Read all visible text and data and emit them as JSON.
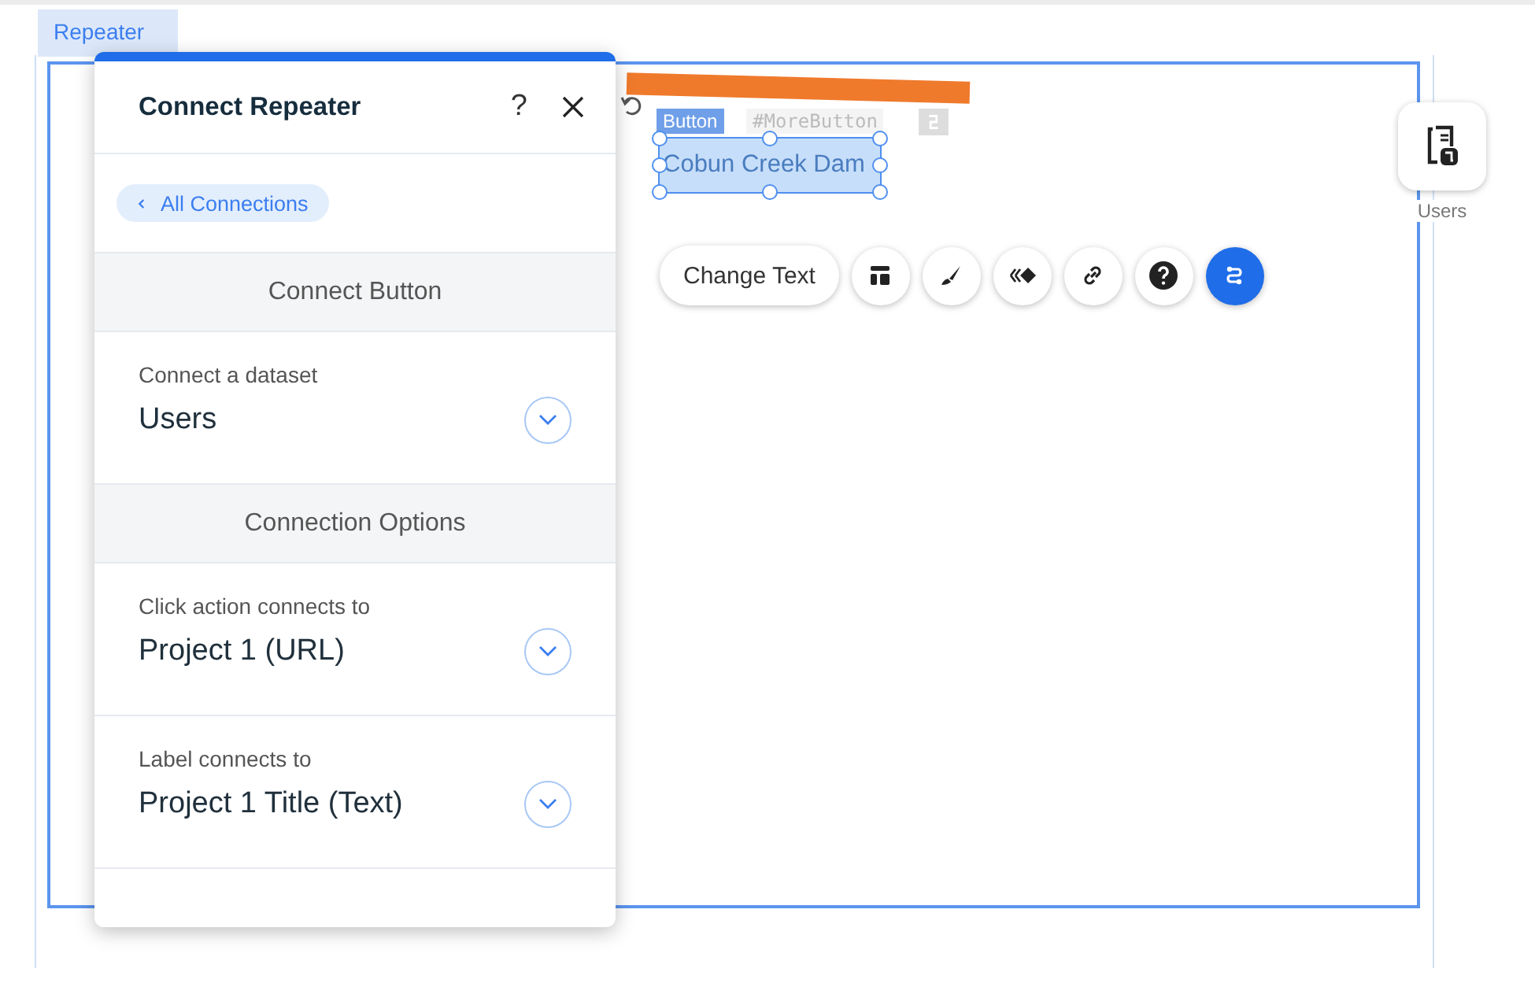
{
  "canvas_tab": {
    "label": "Repeater"
  },
  "panel": {
    "title": "Connect Repeater",
    "help": "?",
    "back_link": "All Connections",
    "sections": [
      {
        "heading": "Connect Button",
        "fields": [
          {
            "label": "Connect a dataset",
            "value": "Users"
          }
        ]
      },
      {
        "heading": "Connection Options",
        "fields": [
          {
            "label": "Click action connects to",
            "value": "Project 1 (URL)"
          },
          {
            "label": "Label connects to",
            "value": "Project 1 Title (Text)"
          }
        ]
      }
    ]
  },
  "element": {
    "type_tag": "Button",
    "id_tag": "#MoreButton",
    "text": "Cobun Creek Dam",
    "selected": true
  },
  "toolbar": {
    "primary": "Change Text",
    "icons": [
      {
        "kind": "layout"
      },
      {
        "kind": "design"
      },
      {
        "kind": "animation"
      },
      {
        "kind": "link"
      },
      {
        "kind": "help"
      },
      {
        "kind": "connect"
      }
    ]
  },
  "dataset": {
    "label": "Users"
  }
}
